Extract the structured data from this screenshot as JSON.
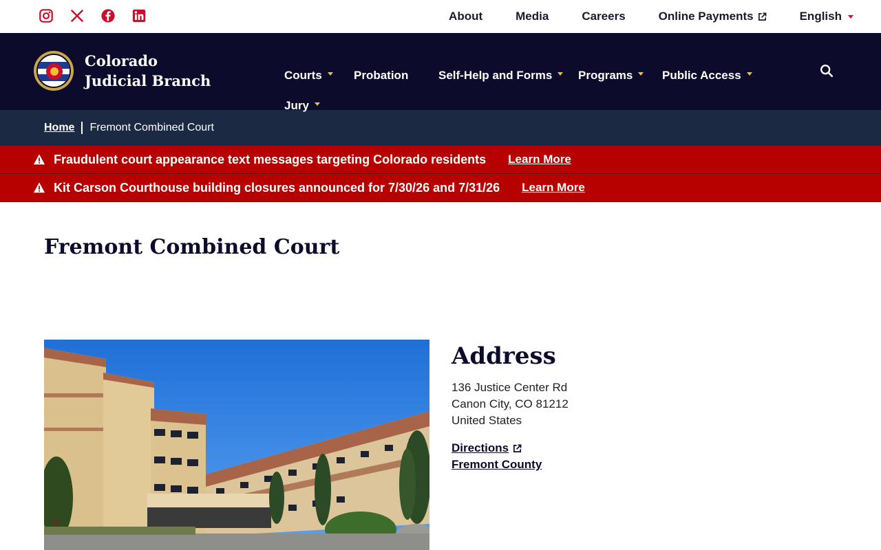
{
  "social": [
    {
      "name": "instagram-icon",
      "label": "Instagram"
    },
    {
      "name": "x-icon",
      "label": "X"
    },
    {
      "name": "facebook-icon",
      "label": "Facebook"
    },
    {
      "name": "linkedin-icon",
      "label": "LinkedIn"
    }
  ],
  "utility_nav": {
    "about": "About",
    "media": "Media",
    "careers": "Careers",
    "online_payments": "Online Payments",
    "language": "English"
  },
  "brand": {
    "name": "Colorado Judicial Branch"
  },
  "main_nav": {
    "courts": "Courts",
    "probation": "Probation",
    "self_help": "Self-Help and Forms",
    "programs": "Programs",
    "public_access": "Public Access",
    "jury": "Jury"
  },
  "breadcrumb": {
    "home": "Home",
    "current": "Fremont Combined Court"
  },
  "alerts": [
    {
      "message": "Fraudulent court appearance text messages targeting Colorado residents",
      "link": "Learn More"
    },
    {
      "message": "Kit Carson Courthouse building closures announced for 7/30/26 and 7/31/26",
      "link": "Learn More"
    }
  ],
  "page": {
    "title": "Fremont Combined Court"
  },
  "address": {
    "heading": "Address",
    "line1": "136 Justice Center Rd",
    "line2": "Canon City, CO 81212",
    "line3": "United States",
    "directions": "Directions",
    "county": "Fremont County"
  },
  "colors": {
    "navy": "#0d0b2c",
    "breadcrumb_bg": "#1b2a42",
    "alert_red": "#b70000",
    "accent_gold": "#f2c230",
    "social_red": "#c8102e"
  }
}
